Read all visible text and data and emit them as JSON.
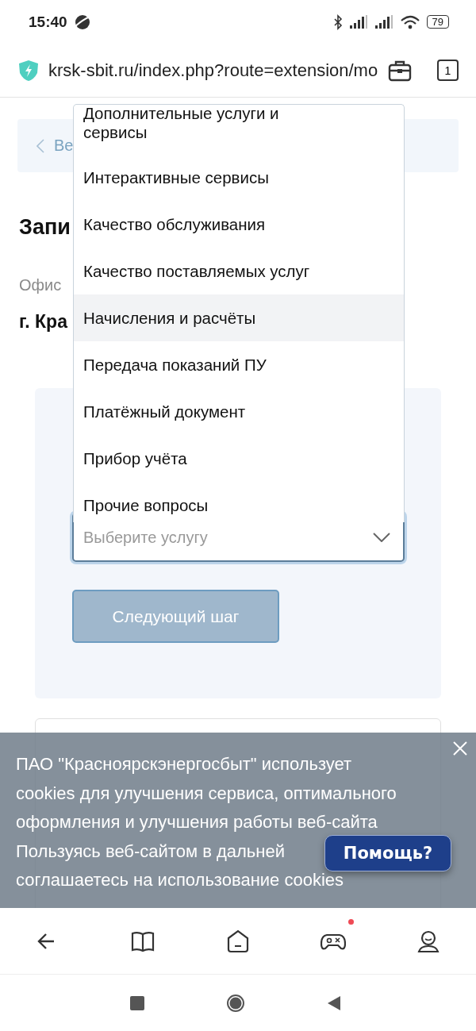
{
  "status_bar": {
    "time": "15:40",
    "battery": "79"
  },
  "browser_bar": {
    "url": "krsk-sbit.ru/index.php?route=extension/mo",
    "tab_count": "1"
  },
  "page": {
    "back_link": "Ве",
    "heading": "Запи",
    "office_label": "Офис",
    "office_value": "г. Кра",
    "step_1": {
      "service_select": {
        "placeholder": "Выберите услугу",
        "expanded": true,
        "options": [
          {
            "label": "Дополнительные услуги и сервисы",
            "selected": false
          },
          {
            "label": "Интерактивные сервисы",
            "selected": false
          },
          {
            "label": "Качество обслуживания",
            "selected": false
          },
          {
            "label": "Качество поставляемых услуг",
            "selected": false
          },
          {
            "label": "Начисления и расчёты",
            "selected": true
          },
          {
            "label": "Передача показаний ПУ",
            "selected": false
          },
          {
            "label": "Платёжный документ",
            "selected": false
          },
          {
            "label": "Прибор учёта",
            "selected": false
          },
          {
            "label": "Прочие вопросы",
            "selected": false
          }
        ]
      },
      "next_button": {
        "label": "Следующий шаг",
        "disabled": true
      }
    }
  },
  "cookie_banner": {
    "lines": [
      "ПАО \"Красноярскэнергосбыт\" использует",
      "cookies для улучшения сервиса, оптимального",
      "оформления и улучшения работы веб-сайта",
      "Пользуясь веб-сайтом в дальней",
      "соглашаетесь на использование cookies"
    ]
  },
  "help_button": "Помощь?",
  "bottom_nav": [
    {
      "kind": "back",
      "badge": false
    },
    {
      "kind": "book",
      "badge": false
    },
    {
      "kind": "home",
      "badge": false
    },
    {
      "kind": "game",
      "badge": true
    },
    {
      "kind": "profile",
      "badge": false
    }
  ],
  "system_nav": [
    {
      "kind": "recents"
    },
    {
      "kind": "home"
    },
    {
      "kind": "back"
    }
  ]
}
